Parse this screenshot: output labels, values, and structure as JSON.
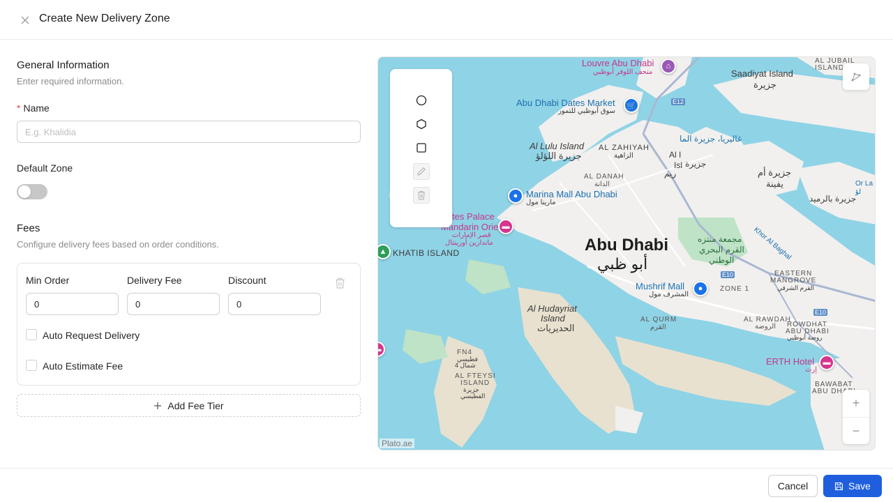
{
  "header": {
    "title": "Create New Delivery Zone",
    "close_icon": "close-icon"
  },
  "general": {
    "title": "General Information",
    "subtitle": "Enter required information.",
    "name_label": "Name",
    "name_required_mark": "*",
    "name_placeholder": "E.g. Khalidia",
    "name_value": "",
    "default_zone_label": "Default Zone",
    "default_zone_on": false
  },
  "fees": {
    "title": "Fees",
    "subtitle": "Configure delivery fees based on order conditions.",
    "tier": {
      "min_order_label": "Min Order",
      "min_order_value": "0",
      "delivery_fee_label": "Delivery Fee",
      "delivery_fee_value": "0",
      "discount_label": "Discount",
      "discount_value": "0",
      "auto_request_label": "Auto Request Delivery",
      "auto_request_checked": false,
      "auto_estimate_label": "Auto Estimate Fee",
      "auto_estimate_checked": false
    },
    "add_tier_label": "Add Fee Tier"
  },
  "map": {
    "attribution": "Plato.ae",
    "tools": [
      "circle-tool",
      "polygon-tool",
      "rectangle-tool",
      "edit-tool",
      "delete-tool"
    ],
    "labels": {
      "louvre_en": "Louvre Abu Dhabi",
      "louvre_ar": "متحف اللوفر أبوظبي",
      "dates_market_en": "Abu Dhabi Dates Market",
      "dates_market_ar": "سوق أبوظبي للتمور",
      "saadiyat_en": "Saadiyat Island",
      "saadiyat_ar": "جزيرة",
      "al_jubail": "AL JUBAIL",
      "island": "ISLAND",
      "al_lulu_en": "Al Lulu Island",
      "al_lulu_ar": "جزيرة اللؤلؤ",
      "al_zahiyah": "AL ZAHIYAH",
      "al_zahiyah_ar": "الزاهية",
      "galleria_ar": "غاليريا، جزيرة الما",
      "al_reem_1": "Al I",
      "al_reem_2": "Isl",
      "reem_ar": "جزيرة",
      "reem_ar2": "ريم",
      "um_yifeenah_ar": "جزيرة أم",
      "um_yifeenah_ar2": "يفينة",
      "ramid_ar": "جزيرة بالرميد",
      "al_danah": "AL DANAH",
      "al_danah_ar": "الدانة",
      "marina_mall_en": "Marina Mall Abu Dhabi",
      "marina_mall_ar": "مارينا مول",
      "palace_en": "tes Palace",
      "mandarin_en": "Mandarin Oriental",
      "palace_ar": "قصر الإمارات",
      "mandarin_ar": "ماندارين أورينتال",
      "khatib": "KHATIB ISLAND",
      "abu_dhabi_en": "Abu Dhabi",
      "abu_dhabi_ar": "أبو ظبي",
      "mangrove_ar": "مجمعة منتزه",
      "mangrove_ar2": "القرم البحري",
      "mangrove_ar3": "الوطني",
      "khor": "Khor Al Baghal",
      "eastern_mangrove": "EASTERN",
      "eastern_mangrove2": "MANGROVE",
      "eastern_ar": "القرم الشرقي",
      "mushrif_en": "Mushrif Mall",
      "mushrif_ar": "المشرف مول",
      "zone1": "ZONE 1",
      "hudayriat_en": "Al Hudayriat",
      "hudayriat_en2": "Island",
      "hudayriat_ar": "الحديريات",
      "al_qurm": "AL QURM",
      "al_qurm_ar": "القرم",
      "al_rawdah": "AL RAWDAH",
      "al_rawdah_ar": "الروضة",
      "rowdhat": "ROWDHAT",
      "rowdhat2": "ABU DHABI",
      "rowdhat_ar": "روضة أبوظبي",
      "erth_en": "ERTH Hotel",
      "erth_ar": "إرث",
      "fn4": "FN4",
      "fn4_ar": "فطيسي",
      "fn4_ar2": "شمال 4",
      "al_fteysi": "AL FTEYSI",
      "al_fteysi_ar": "جزيرة",
      "al_fteysi_ar2": "الفطيسي",
      "bawabat": "BAWABAT",
      "bawabat2": "ABU DHABI",
      "e10": "E10",
      "e12": "E12",
      "ora_la": "Or La",
      "ora_la2": "لؤ"
    }
  },
  "footer": {
    "cancel_label": "Cancel",
    "save_label": "Save"
  }
}
